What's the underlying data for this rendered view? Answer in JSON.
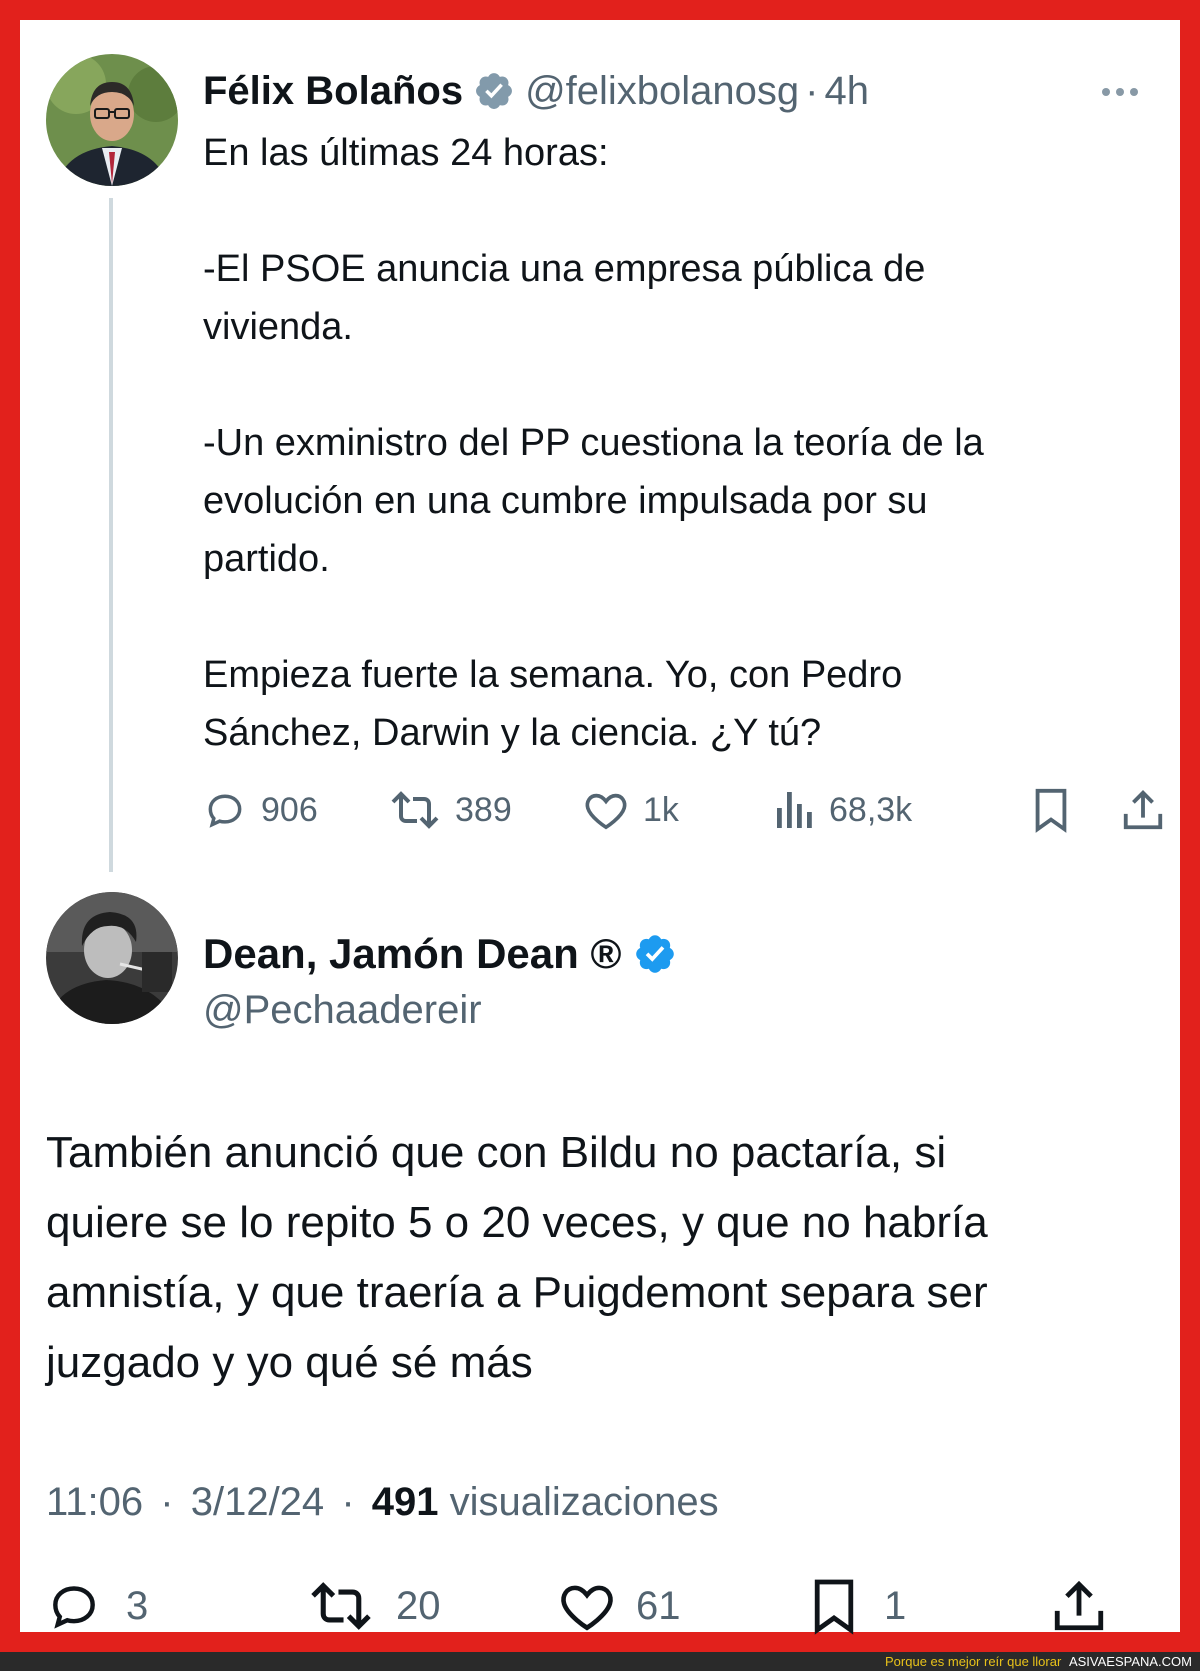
{
  "tweet1": {
    "name": "Félix Bolaños",
    "handle": "@felixbolanosg",
    "separator": "·",
    "time": "4h",
    "body": [
      "En las últimas 24 horas:",
      "",
      "-El PSOE anuncia una empresa pública de",
      "vivienda.",
      "",
      "-Un exministro del PP cuestiona la teoría de la",
      "evolución en una cumbre impulsada por su",
      "partido.",
      "",
      "Empieza fuerte la semana. Yo, con Pedro",
      "Sánchez, Darwin y la ciencia. ¿Y tú?"
    ],
    "replies": "906",
    "reposts": "389",
    "likes": "1k",
    "views": "68,3k",
    "verified_color": "#829aab"
  },
  "tweet2": {
    "name": "Dean, Jamón Dean ®",
    "handle": "@Pechaadereir",
    "body": [
      "También anunció que con Bildu no pactaría, si",
      "quiere se lo repito 5 o 20 veces, y que no habría",
      "amnistía, y que traería a Puigdemont separa ser",
      "juzgado y yo qué sé más"
    ],
    "time": "11:06",
    "separator": "·",
    "date": "3/12/24",
    "views_count": "491",
    "views_label": "visualizaciones",
    "replies": "3",
    "reposts": "20",
    "likes": "61",
    "bookmarks": "1",
    "verified_color": "#1d9bf0"
  },
  "footer": {
    "tagline": "Porque es mejor reír que llorar",
    "site": "ASIVAESPANA.COM"
  },
  "colors": {
    "frame": "#e2211c",
    "secondary_text": "#536471",
    "footer_tagline": "#e8c21a"
  }
}
